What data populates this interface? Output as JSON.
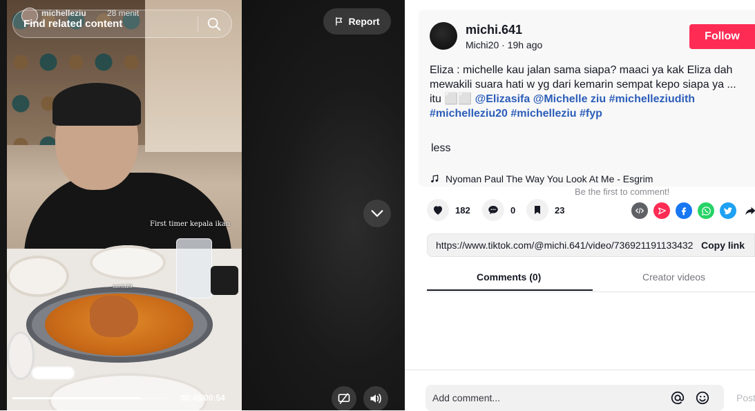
{
  "video": {
    "search_text": "Find related content",
    "overlay_username": "michelleziu",
    "overlay_time": "28 menit",
    "caption_text": "First timer kepala ikan",
    "watermark_text": "michi20",
    "report_label": "Report",
    "time_display": "00:45/00:54",
    "progress": 0.83
  },
  "post": {
    "username": "michi.641",
    "subline": "Michi20 · 19h ago",
    "follow_label": "Follow",
    "desc_main": "Eliza : michelle kau jalan sama siapa? maaci ya kak Eliza dah mewakili suara hati w yg dari kemarin sempat kepo siapa ya ... itu ⬜⬜ ",
    "tags": [
      "@Elizasifa",
      "@Michelle ziu",
      "#michelleziudith",
      "#michelleziu20",
      "#michelleziu",
      "#fyp"
    ],
    "less_label": "less",
    "music": "Nyoman Paul The Way You Look At Me - Esgrim",
    "first_comment": "Be the first to comment!"
  },
  "stats": {
    "likes": "182",
    "comments": "0",
    "saves": "23"
  },
  "share": {
    "icons": [
      "embed-icon",
      "send-icon",
      "facebook-icon",
      "whatsapp-icon",
      "twitter-icon",
      "share-arrow-icon"
    ],
    "colors": {
      "embed": "#5f6066",
      "send": "#fe2c55",
      "facebook": "#1877f2",
      "whatsapp": "#25d366",
      "twitter": "#1da1f2"
    }
  },
  "link": {
    "url": "https://www.tiktok.com/@michi.641/video/736921191133432",
    "copy_label": "Copy link"
  },
  "tabs": {
    "comments": "Comments (0)",
    "creator": "Creator videos"
  },
  "comment_box": {
    "placeholder": "Add comment...",
    "post_label": "Post"
  },
  "colors": {
    "accent": "#fe2c55",
    "hashtag": "#2b5db9"
  }
}
